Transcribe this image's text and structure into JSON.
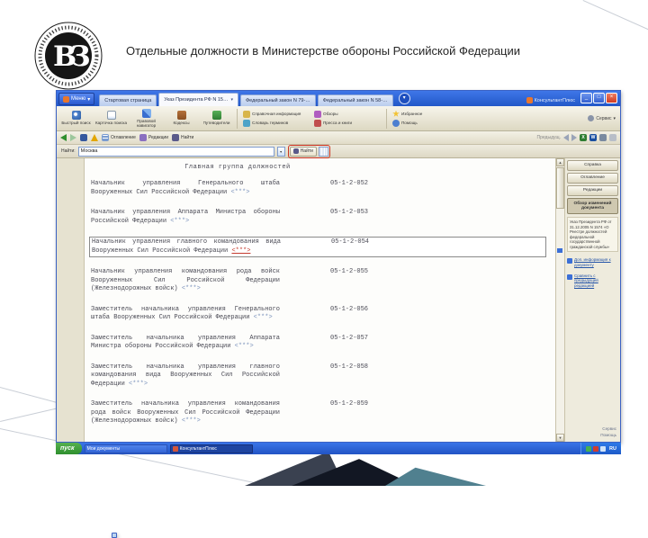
{
  "slide": {
    "title": "Отдельные должности в Министерстве обороны Российской Федерации",
    "logo_monogram": "ВЗ"
  },
  "window": {
    "menu_button": "Меню",
    "brand": "КонсультантПлюс",
    "tabs": [
      {
        "label": "Стартовая страница",
        "active": false
      },
      {
        "label": "Указ Президента РФ N 15…",
        "active": true
      },
      {
        "label": "Федеральный закон N 79-…",
        "active": false
      },
      {
        "label": "Федеральный закон N 58-…",
        "active": false
      }
    ],
    "toolbar": {
      "primary": [
        {
          "label": "Быстрый поиск",
          "icon": "search-icon"
        },
        {
          "label": "Карточка поиска",
          "icon": "card-search-icon"
        },
        {
          "label": "Правовой навигатор",
          "icon": "navigator-icon"
        },
        {
          "label": "Кодексы",
          "icon": "codes-icon"
        },
        {
          "label": "Путеводители",
          "icon": "guides-icon"
        }
      ],
      "secondary": [
        {
          "label": "Справочная информация",
          "icon": "info-icon"
        },
        {
          "label": "Обзоры",
          "icon": "reviews-icon"
        },
        {
          "label": "Словарь терминов",
          "icon": "dictionary-icon"
        },
        {
          "label": "Пресса и книги",
          "icon": "press-icon"
        }
      ],
      "right": [
        {
          "label": "Избранное",
          "icon": "star-icon"
        },
        {
          "label": "Помощь",
          "icon": "help-icon"
        }
      ],
      "far_right": "Сервис"
    },
    "doc_toolbar": {
      "left": [
        {
          "icon": "back-icon"
        },
        {
          "icon": "forward-icon"
        },
        {
          "icon": "save-icon"
        },
        {
          "icon": "alert-icon"
        },
        {
          "icon": "toc-icon",
          "label": "Оглавление"
        },
        {
          "icon": "editions-icon",
          "label": "Редакции"
        },
        {
          "icon": "find-icon",
          "label": "Найти"
        }
      ],
      "right_hint": "Предыдущ.",
      "right_icons": [
        "prev-icon",
        "next-icon",
        "excel-icon",
        "word-icon",
        "export-icon",
        "print-icon"
      ]
    },
    "search": {
      "label": "Найти:",
      "value": "Москва",
      "button": "Найти"
    },
    "sidebar": {
      "buttons": [
        "Справка",
        "Оглавление",
        "Редакции"
      ],
      "active_button": "Обзор изменений документа",
      "note": "Указ Президента РФ от 31.12.2005 N 1574 «О Реестре должностей федеральной государственной гражданской службы»",
      "links": [
        "Доп. информация к документу",
        "Сравнить с предыдущей редакцией"
      ],
      "footer_links": [
        "Сервис",
        "Помощь"
      ]
    },
    "document": {
      "heading": "Главная группа должностей",
      "footnote_mark": "<***>",
      "entries": [
        {
          "text": "Начальник управления Генерального штаба Вооруженных Сил Российской Федерации",
          "code": "05-1-2-052",
          "selected": false
        },
        {
          "text": "Начальник управления Аппарата Министра обороны Российской Федерации",
          "code": "05-1-2-053",
          "selected": false
        },
        {
          "text": "Начальник управления главного командования вида Вооруженных Сил Российской Федерации",
          "code": "05-1-2-054",
          "selected": true
        },
        {
          "text": "Начальник управления командования рода войск Вооруженных Сил Российской Федерации (Железнодорожных войск)",
          "code": "05-1-2-055",
          "selected": false
        },
        {
          "text": "Заместитель начальника управления Генерального штаба Вооруженных Сил Российской Федерации",
          "code": "05-1-2-056",
          "selected": false
        },
        {
          "text": "Заместитель начальника управления Аппарата Министра обороны Российской Федерации",
          "code": "05-1-2-057",
          "selected": false
        },
        {
          "text": "Заместитель начальника управления главного командования вида Вооруженных Сил Российской Федерации",
          "code": "05-1-2-058",
          "selected": false
        },
        {
          "text": "Заместитель начальника управления командования рода войск Вооруженных Сил Российской Федерации (Железнодорожных войск)",
          "code": "05-1-2-059",
          "selected": false
        }
      ]
    }
  },
  "taskbar": {
    "start": "пуск",
    "items": [
      {
        "label": "Мои документы",
        "icon": "window-icon",
        "active": false
      },
      {
        "label": "КонсультантПлюс",
        "icon": "consultant-icon",
        "active": true
      }
    ],
    "tray_lang": "RU"
  },
  "colors": {
    "titlebar_blue": "#2a5fd0",
    "taskbar_blue": "#2a5ad0",
    "start_green": "#3c9a38",
    "selected_mark_red": "#c43b2f",
    "link_blue": "#2353a8",
    "teal_triangle": "#50808f"
  }
}
